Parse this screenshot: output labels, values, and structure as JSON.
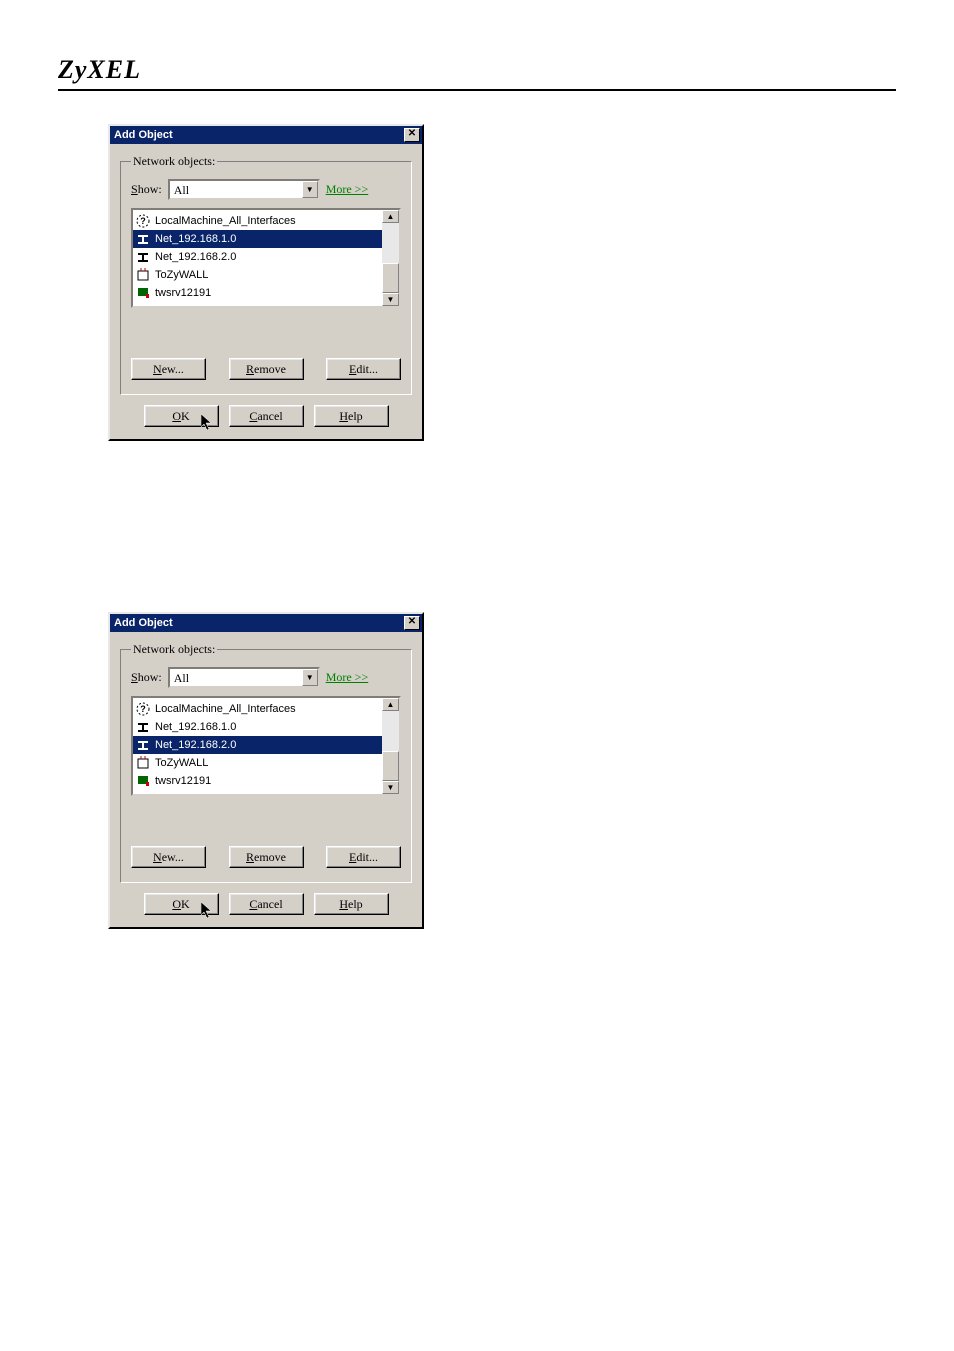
{
  "brand": "ZyXEL",
  "dialogs": [
    {
      "title": "Add Object",
      "group_label": "Network objects:",
      "show_label_prefix": "S",
      "show_label_rest": "how:",
      "show_value": "All",
      "more_link": "More >>",
      "items": [
        {
          "icon": "question",
          "label": "LocalMachine_All_Interfaces",
          "selected": false
        },
        {
          "icon": "network",
          "label": "Net_192.168.1.0",
          "selected": true
        },
        {
          "icon": "network",
          "label": "Net_192.168.2.0",
          "selected": false
        },
        {
          "icon": "device",
          "label": "ToZyWALL",
          "selected": false
        },
        {
          "icon": "host",
          "label": "twsrv12191",
          "selected": false
        }
      ],
      "buttons": {
        "new_u": "N",
        "new_rest": "ew...",
        "remove_u": "R",
        "remove_rest": "emove",
        "edit_u": "E",
        "edit_rest": "dit...",
        "ok_u": "O",
        "ok_rest": "K",
        "cancel_u": "C",
        "cancel_rest": "ancel",
        "help_u": "H",
        "help_rest": "elp"
      }
    },
    {
      "title": "Add Object",
      "group_label": "Network objects:",
      "show_label_prefix": "S",
      "show_label_rest": "how:",
      "show_value": "All",
      "more_link": "More >>",
      "items": [
        {
          "icon": "question",
          "label": "LocalMachine_All_Interfaces",
          "selected": false
        },
        {
          "icon": "network",
          "label": "Net_192.168.1.0",
          "selected": false
        },
        {
          "icon": "network",
          "label": "Net_192.168.2.0",
          "selected": true
        },
        {
          "icon": "device",
          "label": "ToZyWALL",
          "selected": false
        },
        {
          "icon": "host",
          "label": "twsrv12191",
          "selected": false
        }
      ],
      "buttons": {
        "new_u": "N",
        "new_rest": "ew...",
        "remove_u": "R",
        "remove_rest": "emove",
        "edit_u": "E",
        "edit_rest": "dit...",
        "ok_u": "O",
        "ok_rest": "K",
        "cancel_u": "C",
        "cancel_rest": "ancel",
        "help_u": "H",
        "help_rest": "elp"
      }
    }
  ]
}
